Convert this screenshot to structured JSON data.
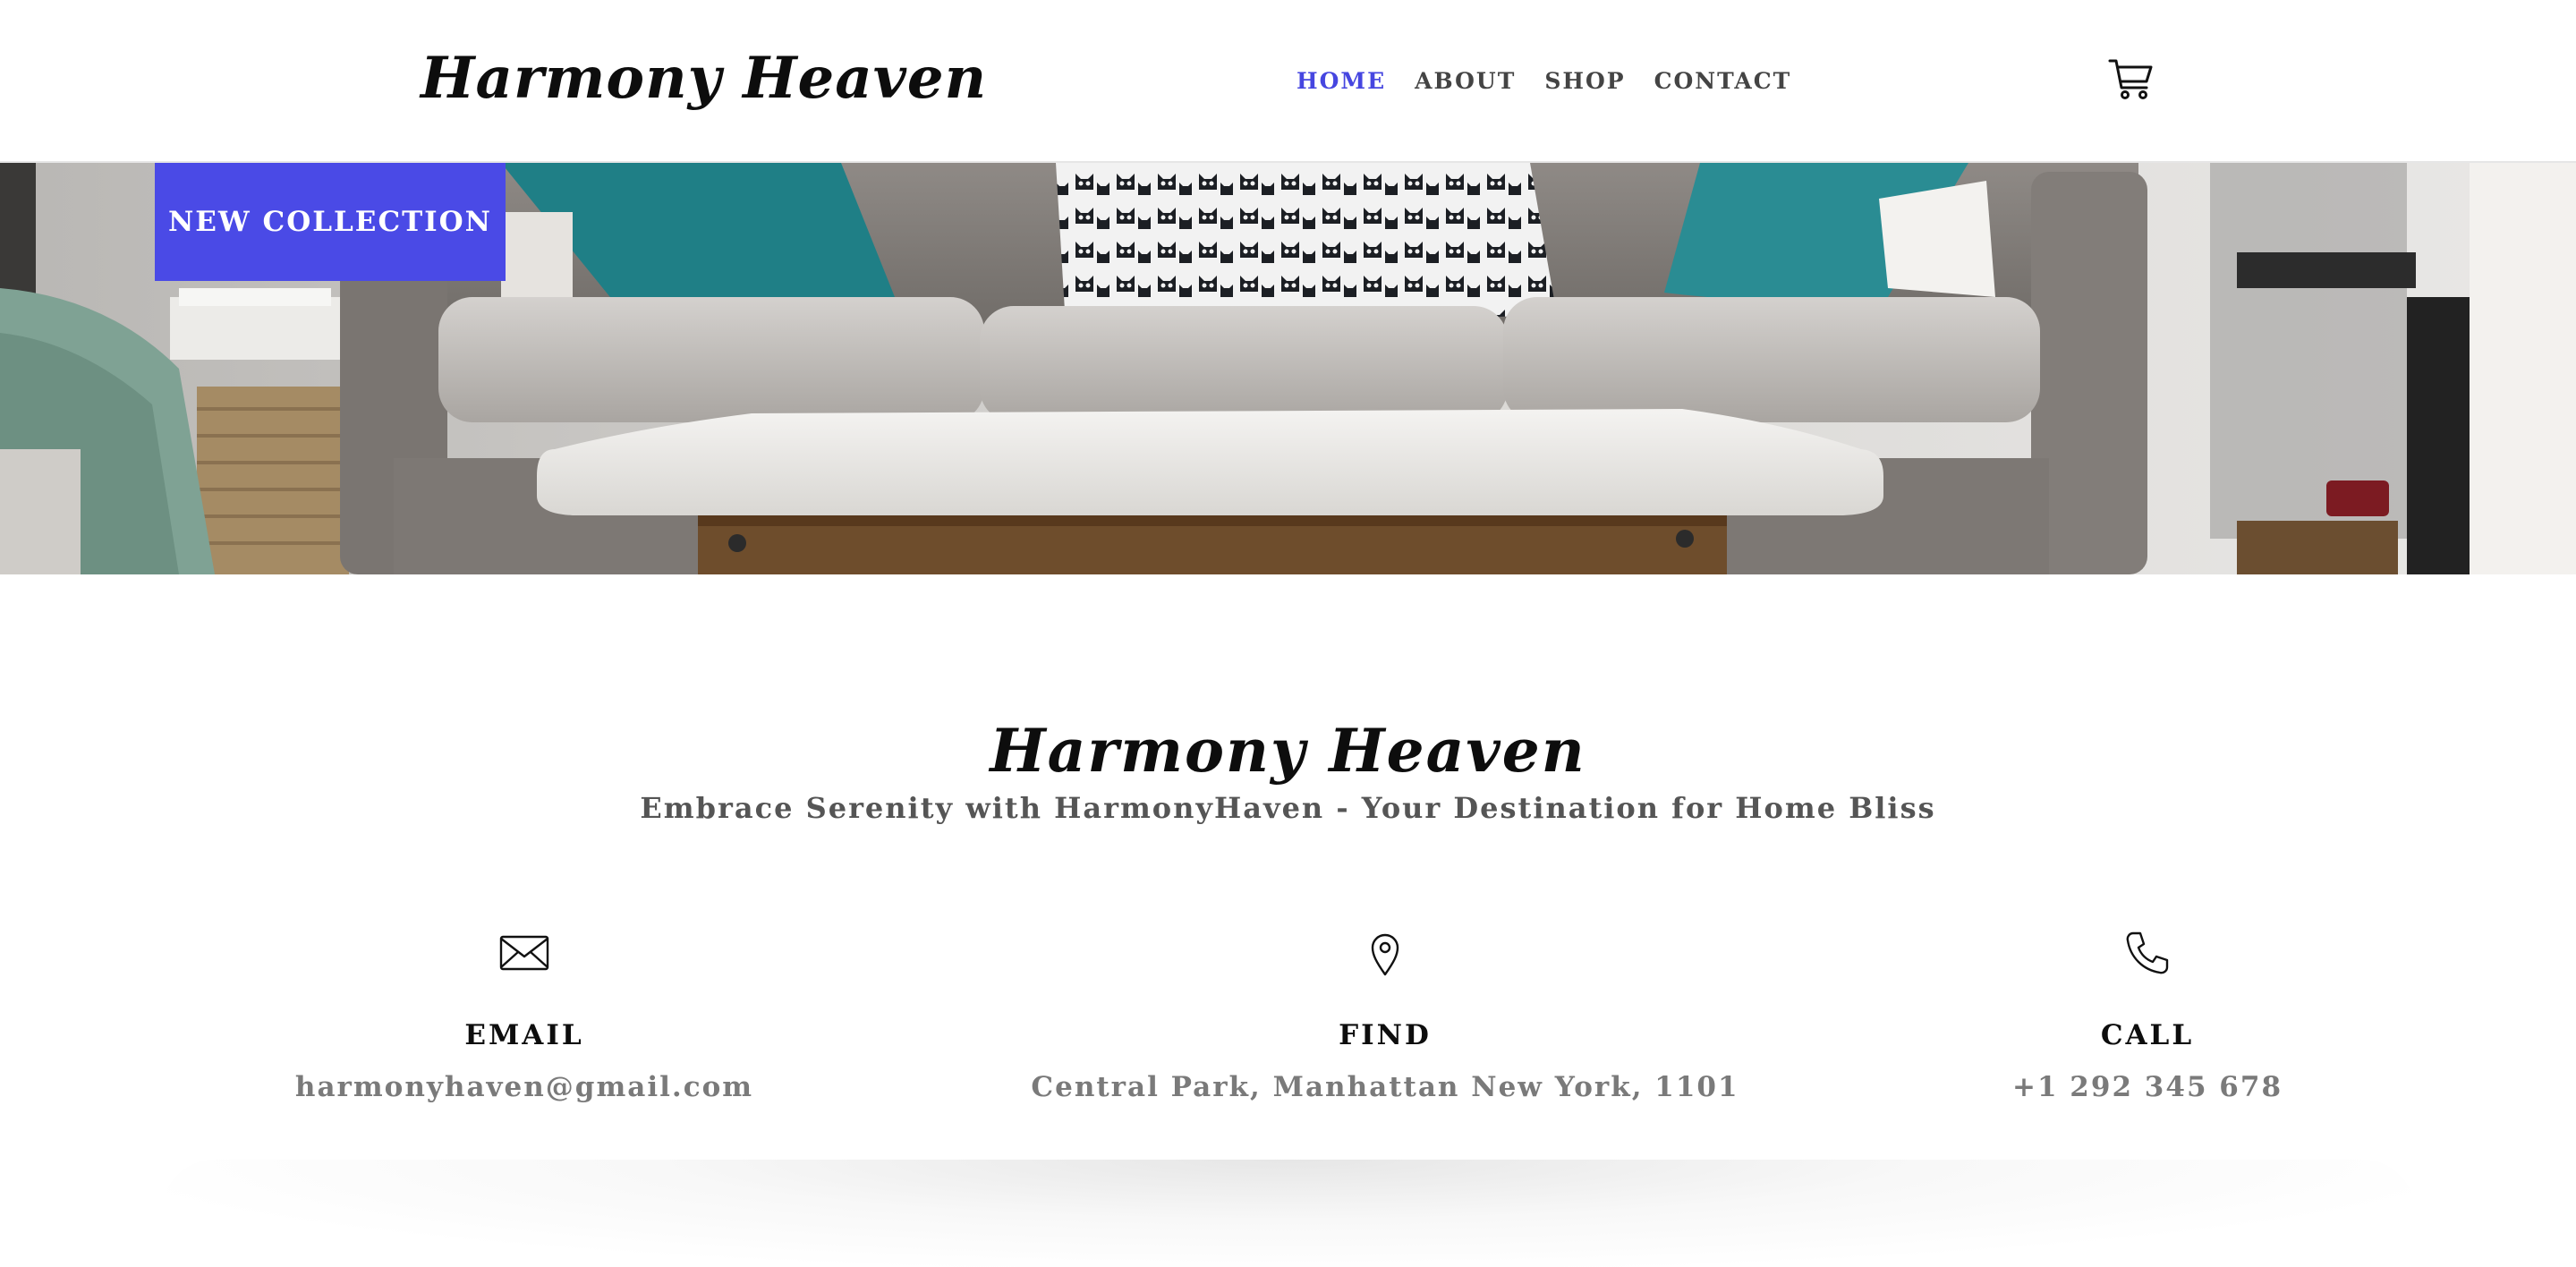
{
  "header": {
    "logo": "Harmony Heaven",
    "nav": [
      {
        "label": "HOME",
        "active": true
      },
      {
        "label": "ABOUT",
        "active": false
      },
      {
        "label": "SHOP",
        "active": false
      },
      {
        "label": "CONTACT",
        "active": false
      }
    ],
    "cart_icon": "shopping-cart-icon"
  },
  "hero": {
    "button_label": "NEW COLLECTION"
  },
  "about": {
    "title": "Harmony Heaven",
    "tagline": "Embrace Serenity with HarmonyHaven - Your Destination for Home Bliss"
  },
  "contact": [
    {
      "icon": "envelope-icon",
      "label": "EMAIL",
      "value": "harmonyhaven@gmail.com"
    },
    {
      "icon": "map-pin-icon",
      "label": "FIND",
      "value": "Central Park, Manhattan New York, 1101"
    },
    {
      "icon": "phone-icon",
      "label": "CALL",
      "value": "+1 292 345 678"
    }
  ],
  "colors": {
    "accent": "#4a4ae6",
    "nav_active": "#4646e0",
    "text_dark": "#0d0d0d",
    "text_muted": "#7a7a7a"
  }
}
